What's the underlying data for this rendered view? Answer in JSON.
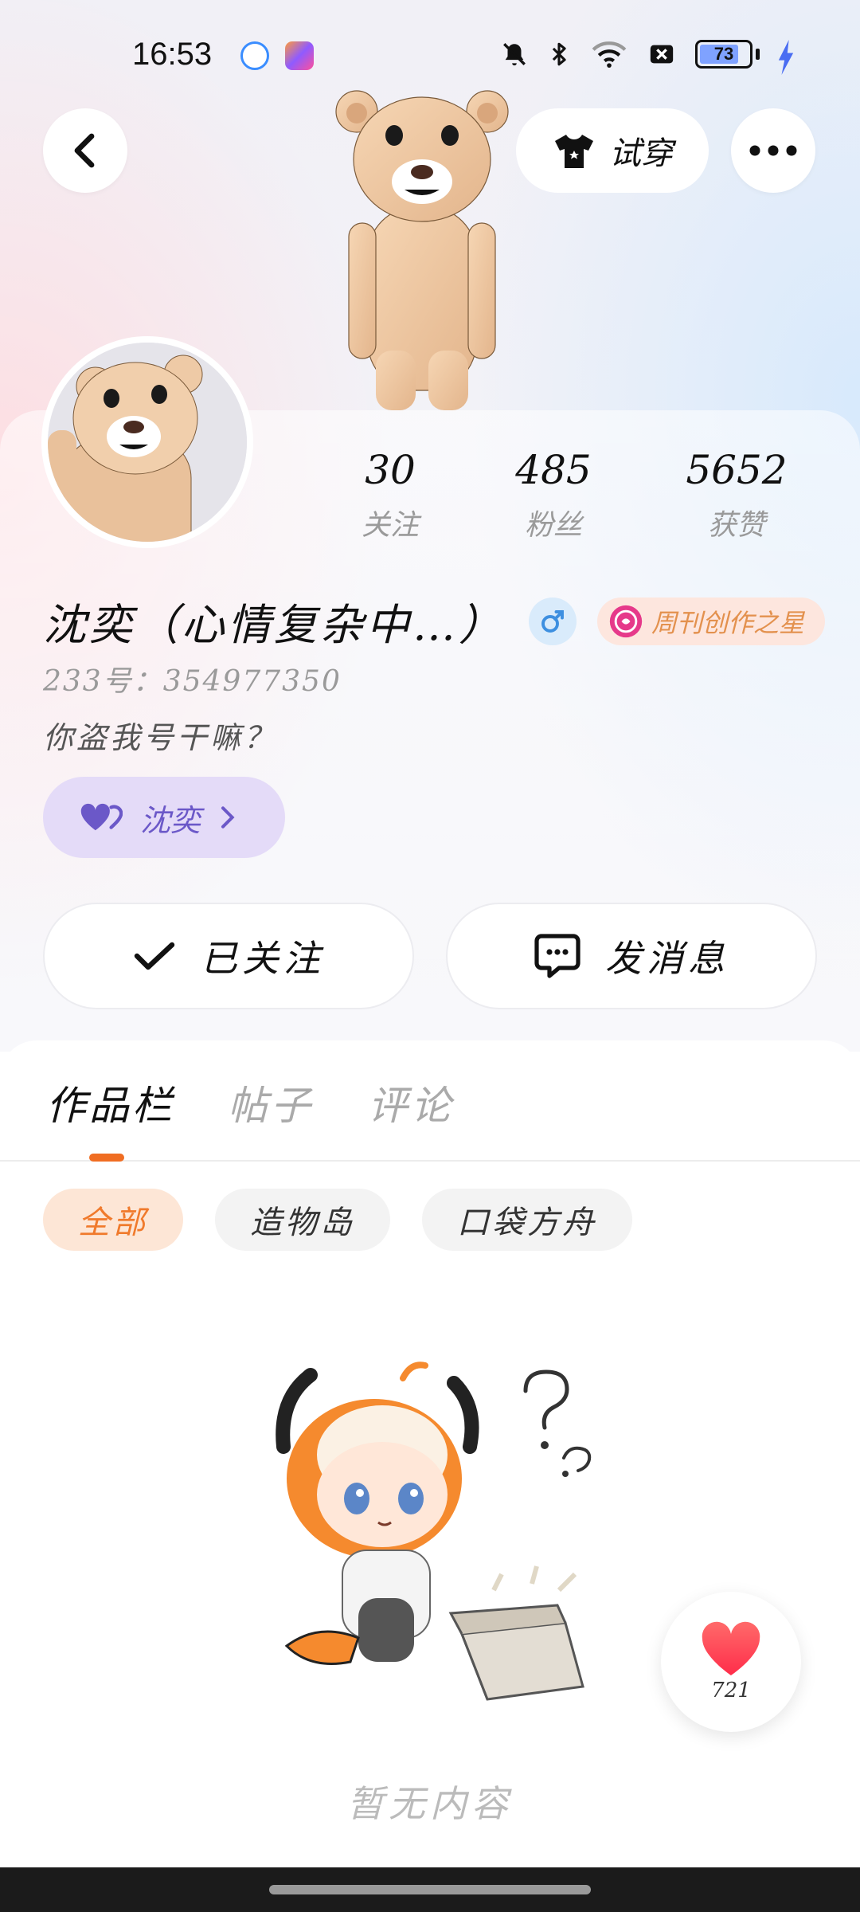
{
  "status_bar": {
    "time": "16:53",
    "battery_level": "73",
    "icons": [
      "app-search-icon",
      "app-gallery-icon",
      "mute-icon",
      "bluetooth-icon",
      "wifi-icon",
      "sim-off-icon",
      "battery-icon",
      "charging-icon"
    ]
  },
  "top_nav": {
    "try_on_label": "试穿"
  },
  "profile": {
    "stats": [
      {
        "value": "30",
        "label": "关注"
      },
      {
        "value": "485",
        "label": "粉丝"
      },
      {
        "value": "5652",
        "label": "获赞"
      }
    ],
    "name": "沈奕（心情复杂中…）",
    "gender": "♂",
    "badge_label": "周刊创作之星",
    "uid": "233号：354977350",
    "bio": "你盗我号干嘛？",
    "link_label": "沈奕",
    "follow_label": "已关注",
    "message_label": "发消息"
  },
  "content": {
    "tabs": [
      "作品栏",
      "帖子",
      "评论"
    ],
    "active_tab": 0,
    "chips": [
      "全部",
      "造物岛",
      "口袋方舟"
    ],
    "active_chip": 0,
    "empty_text": "暂无内容"
  },
  "floating_like": {
    "count": "721"
  },
  "colors": {
    "accent_orange": "#f06d22",
    "link_purple": "#6b58c8",
    "badge_orange": "#e3914e"
  }
}
